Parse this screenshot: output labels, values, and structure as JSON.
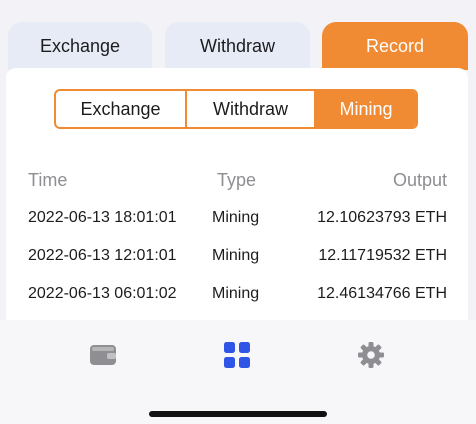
{
  "colors": {
    "accent": "#f08a33",
    "inactive_tab": "#e6ebf5",
    "icon_gray": "#8e8e93",
    "icon_active": "#2f55e6"
  },
  "top_tabs": [
    {
      "label": "Exchange",
      "active": false
    },
    {
      "label": "Withdraw",
      "active": false
    },
    {
      "label": "Record",
      "active": true
    }
  ],
  "segment": [
    {
      "label": "Exchange",
      "active": false
    },
    {
      "label": "Withdraw",
      "active": false
    },
    {
      "label": "Mining",
      "active": true
    }
  ],
  "table": {
    "headers": {
      "time": "Time",
      "type": "Type",
      "output": "Output"
    },
    "rows": [
      {
        "time": "2022-06-13 18:01:01",
        "type": "Mining",
        "output": "12.10623793 ETH"
      },
      {
        "time": "2022-06-13 12:01:01",
        "type": "Mining",
        "output": "12.11719532 ETH"
      },
      {
        "time": "2022-06-13 06:01:02",
        "type": "Mining",
        "output": "12.46134766 ETH"
      }
    ]
  },
  "bottom_nav": [
    {
      "icon": "wallet-icon",
      "active": false
    },
    {
      "icon": "grid-icon",
      "active": true
    },
    {
      "icon": "gear-icon",
      "active": false
    }
  ]
}
